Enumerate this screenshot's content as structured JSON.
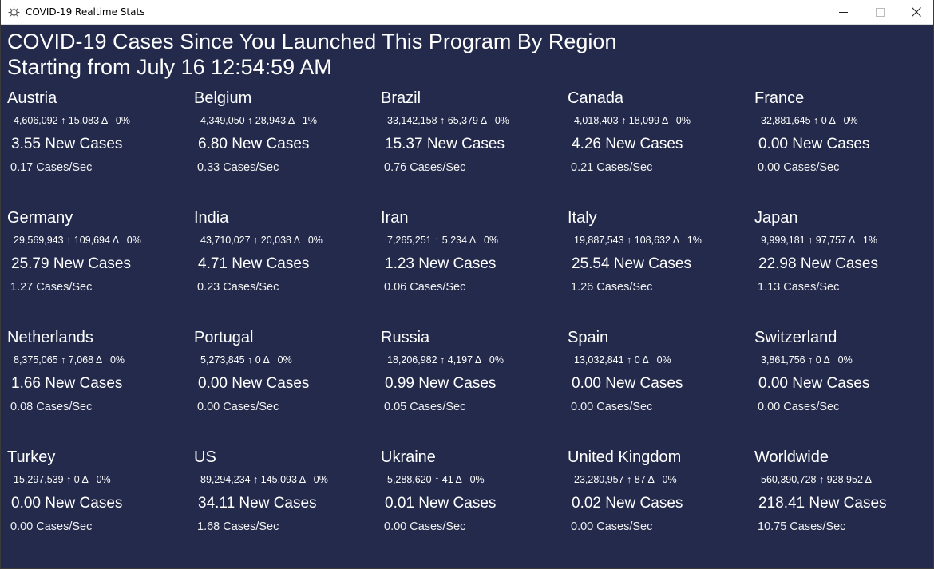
{
  "window": {
    "title": "COVID-19 Realtime Stats",
    "icon": "virus-icon"
  },
  "header": {
    "line1": "COVID-19 Cases Since You Launched This Program By Region",
    "line2": "Starting from July 16 12:54:59 AM"
  },
  "regions": [
    {
      "name": "Austria",
      "stats": "4,606,092 ↑ 15,083 Δ   0%",
      "new_cases": "3.55 New Cases",
      "rate": "0.17 Cases/Sec"
    },
    {
      "name": "Belgium",
      "stats": "4,349,050 ↑ 28,943 Δ   1%",
      "new_cases": "6.80 New Cases",
      "rate": "0.33 Cases/Sec"
    },
    {
      "name": "Brazil",
      "stats": "33,142,158 ↑ 65,379 Δ   0%",
      "new_cases": "15.37 New Cases",
      "rate": "0.76 Cases/Sec"
    },
    {
      "name": "Canada",
      "stats": "4,018,403 ↑ 18,099 Δ   0%",
      "new_cases": "4.26 New Cases",
      "rate": "0.21 Cases/Sec"
    },
    {
      "name": "France",
      "stats": "32,881,645 ↑ 0 Δ   0%",
      "new_cases": "0.00 New Cases",
      "rate": "0.00 Cases/Sec"
    },
    {
      "name": "Germany",
      "stats": "29,569,943 ↑ 109,694 Δ   0%",
      "new_cases": "25.79 New Cases",
      "rate": "1.27 Cases/Sec"
    },
    {
      "name": "India",
      "stats": "43,710,027 ↑ 20,038 Δ   0%",
      "new_cases": "4.71 New Cases",
      "rate": "0.23 Cases/Sec"
    },
    {
      "name": "Iran",
      "stats": "7,265,251 ↑ 5,234 Δ   0%",
      "new_cases": "1.23 New Cases",
      "rate": "0.06 Cases/Sec"
    },
    {
      "name": "Italy",
      "stats": "19,887,543 ↑ 108,632 Δ   1%",
      "new_cases": "25.54 New Cases",
      "rate": "1.26 Cases/Sec"
    },
    {
      "name": "Japan",
      "stats": "9,999,181 ↑ 97,757 Δ   1%",
      "new_cases": "22.98 New Cases",
      "rate": "1.13 Cases/Sec"
    },
    {
      "name": "Netherlands",
      "stats": "8,375,065 ↑ 7,068 Δ   0%",
      "new_cases": "1.66 New Cases",
      "rate": "0.08 Cases/Sec"
    },
    {
      "name": "Portugal",
      "stats": "5,273,845 ↑ 0 Δ   0%",
      "new_cases": "0.00 New Cases",
      "rate": "0.00 Cases/Sec"
    },
    {
      "name": "Russia",
      "stats": "18,206,982 ↑ 4,197 Δ   0%",
      "new_cases": "0.99 New Cases",
      "rate": "0.05 Cases/Sec"
    },
    {
      "name": "Spain",
      "stats": "13,032,841 ↑ 0 Δ   0%",
      "new_cases": "0.00 New Cases",
      "rate": "0.00 Cases/Sec"
    },
    {
      "name": "Switzerland",
      "stats": "3,861,756 ↑ 0 Δ   0%",
      "new_cases": "0.00 New Cases",
      "rate": "0.00 Cases/Sec"
    },
    {
      "name": "Turkey",
      "stats": "15,297,539 ↑ 0 Δ   0%",
      "new_cases": "0.00 New Cases",
      "rate": "0.00 Cases/Sec"
    },
    {
      "name": "US",
      "stats": "89,294,234 ↑ 145,093 Δ   0%",
      "new_cases": "34.11 New Cases",
      "rate": "1.68 Cases/Sec"
    },
    {
      "name": "Ukraine",
      "stats": "5,288,620 ↑ 41 Δ   0%",
      "new_cases": "0.01 New Cases",
      "rate": "0.00 Cases/Sec"
    },
    {
      "name": "United Kingdom",
      "stats": "23,280,957 ↑ 87 Δ   0%",
      "new_cases": "0.02 New Cases",
      "rate": "0.00 Cases/Sec"
    },
    {
      "name": "Worldwide",
      "stats": "560,390,728 ↑ 928,952 Δ",
      "new_cases": "218.41 New Cases",
      "rate": "10.75 Cases/Sec"
    }
  ]
}
